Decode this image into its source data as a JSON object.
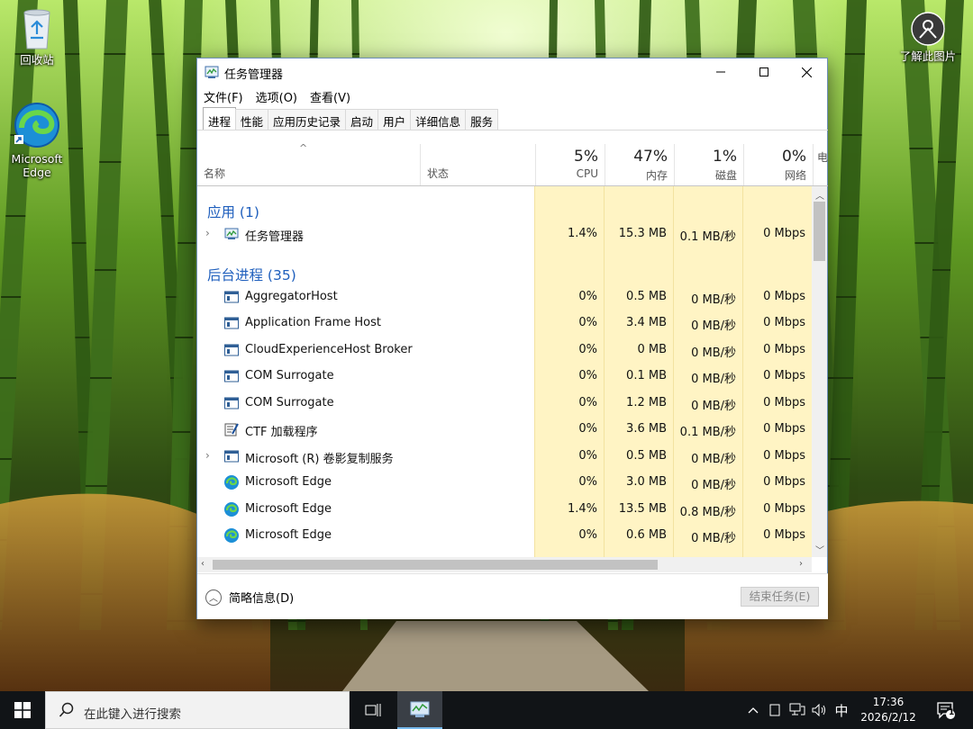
{
  "desktop": {
    "icons": [
      {
        "label": "回收站"
      },
      {
        "label": "Microsoft Edge"
      },
      {
        "label": "了解此图片"
      }
    ]
  },
  "window": {
    "title": "任务管理器",
    "menu": [
      "文件(F)",
      "选项(O)",
      "查看(V)"
    ],
    "tabs": [
      "进程",
      "性能",
      "应用历史记录",
      "启动",
      "用户",
      "详细信息",
      "服务"
    ],
    "active_tab": "进程",
    "header": {
      "name": "名称",
      "status": "状态",
      "columns": [
        {
          "pct": "5%",
          "label": "CPU"
        },
        {
          "pct": "47%",
          "label": "内存"
        },
        {
          "pct": "1%",
          "label": "磁盘"
        },
        {
          "pct": "0%",
          "label": "网络"
        },
        {
          "pct": "",
          "label": "电"
        }
      ]
    },
    "groups": {
      "apps": "应用 (1)",
      "background": "后台进程 (35)"
    },
    "rows": [
      {
        "name": "任务管理器",
        "icon": "task-manager-icon",
        "expand": true,
        "cpu": "1.4%",
        "mem": "15.3 MB",
        "disk": "0.1 MB/秒",
        "net": "0 Mbps"
      },
      {
        "name": "AggregatorHost",
        "icon": "process-window-icon",
        "expand": false,
        "cpu": "0%",
        "mem": "0.5 MB",
        "disk": "0 MB/秒",
        "net": "0 Mbps"
      },
      {
        "name": "Application Frame Host",
        "icon": "process-window-icon",
        "expand": false,
        "cpu": "0%",
        "mem": "3.4 MB",
        "disk": "0 MB/秒",
        "net": "0 Mbps"
      },
      {
        "name": "CloudExperienceHost Broker",
        "icon": "process-window-icon",
        "expand": false,
        "cpu": "0%",
        "mem": "0 MB",
        "disk": "0 MB/秒",
        "net": "0 Mbps"
      },
      {
        "name": "COM Surrogate",
        "icon": "process-window-icon",
        "expand": false,
        "cpu": "0%",
        "mem": "0.1 MB",
        "disk": "0 MB/秒",
        "net": "0 Mbps"
      },
      {
        "name": "COM Surrogate",
        "icon": "process-window-icon",
        "expand": false,
        "cpu": "0%",
        "mem": "1.2 MB",
        "disk": "0 MB/秒",
        "net": "0 Mbps"
      },
      {
        "name": "CTF 加载程序",
        "icon": "ctf-loader-icon",
        "expand": false,
        "cpu": "0%",
        "mem": "3.6 MB",
        "disk": "0.1 MB/秒",
        "net": "0 Mbps"
      },
      {
        "name": "Microsoft (R) 卷影复制服务",
        "icon": "process-window-icon",
        "expand": true,
        "cpu": "0%",
        "mem": "0.5 MB",
        "disk": "0 MB/秒",
        "net": "0 Mbps"
      },
      {
        "name": "Microsoft Edge",
        "icon": "edge-icon",
        "expand": false,
        "cpu": "0%",
        "mem": "3.0 MB",
        "disk": "0 MB/秒",
        "net": "0 Mbps"
      },
      {
        "name": "Microsoft Edge",
        "icon": "edge-icon",
        "expand": false,
        "cpu": "1.4%",
        "mem": "13.5 MB",
        "disk": "0.8 MB/秒",
        "net": "0 Mbps"
      },
      {
        "name": "Microsoft Edge",
        "icon": "edge-icon",
        "expand": false,
        "cpu": "0%",
        "mem": "0.6 MB",
        "disk": "0 MB/秒",
        "net": "0 Mbps"
      }
    ],
    "footer": {
      "collapse_label": "简略信息(D)",
      "end_task_label": "结束任务(E)"
    }
  },
  "taskbar": {
    "search_placeholder": "在此键入进行搜索",
    "ime": "中",
    "time": "17:36",
    "date": "2026/2/12",
    "notification_count": "1"
  },
  "colors": {
    "accent": "#1f5fbd",
    "heat": "#fff4c4",
    "taskbar": "#111417"
  }
}
